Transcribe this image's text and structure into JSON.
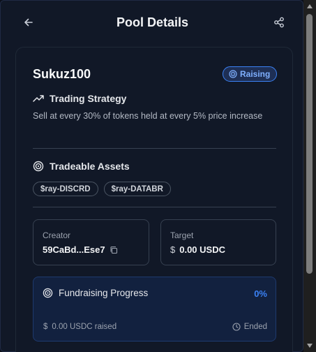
{
  "header": {
    "title": "Pool Details",
    "back_icon": "arrow-left-icon",
    "share_icon": "share-icon"
  },
  "pool": {
    "name": "Sukuz100",
    "status": "Raising",
    "status_color": "#3b82f6"
  },
  "strategy": {
    "heading": "Trading Strategy",
    "description": "Sell at every 30% of tokens held at every 5% price increase"
  },
  "assets": {
    "heading": "Tradeable Assets",
    "items": [
      "$ray-DISCRD",
      "$ray-DATABR"
    ]
  },
  "creator": {
    "label": "Creator",
    "value": "59CaBd...Ese7"
  },
  "target": {
    "label": "Target",
    "currency_symbol": "$",
    "value": "0.00 USDC"
  },
  "fundraising": {
    "heading": "Fundraising Progress",
    "percent": "0%",
    "currency_symbol": "$",
    "raised": "0.00 USDC raised",
    "state": "Ended"
  }
}
